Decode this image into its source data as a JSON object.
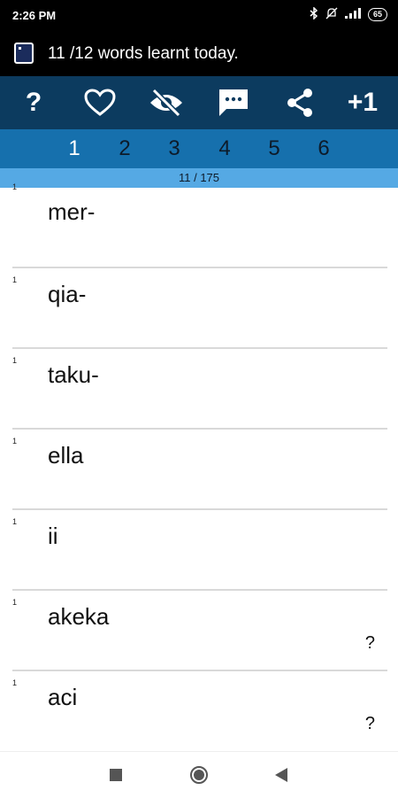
{
  "status": {
    "time": "2:26 PM",
    "battery": "65",
    "icons": [
      "bluetooth-icon",
      "mute-icon",
      "signal-icon",
      "battery-icon"
    ]
  },
  "notification": {
    "text": "11 /12 words learnt today."
  },
  "toolbar": {
    "help_label": "?",
    "plus_label": "+1",
    "icons": [
      "help-icon",
      "heart-icon",
      "eye-off-icon",
      "chat-icon",
      "share-icon",
      "plus-one-icon"
    ]
  },
  "tabs": [
    {
      "label": "1"
    },
    {
      "label": "2"
    },
    {
      "label": "3"
    },
    {
      "label": "4"
    },
    {
      "label": "5"
    },
    {
      "label": "6"
    }
  ],
  "active_tab": "1",
  "progress": "11 / 175",
  "words": [
    {
      "num": "1",
      "word": "mer-",
      "hint": ""
    },
    {
      "num": "1",
      "word": "qia-",
      "hint": ""
    },
    {
      "num": "1",
      "word": "taku-",
      "hint": ""
    },
    {
      "num": "1",
      "word": "ella",
      "hint": ""
    },
    {
      "num": "1",
      "word": "ii",
      "hint": ""
    },
    {
      "num": "1",
      "word": "akeka",
      "hint": "?"
    },
    {
      "num": "1",
      "word": "aci",
      "hint": "?"
    }
  ],
  "colors": {
    "toolbar": "#0c3b5f",
    "tabs": "#1670ad",
    "progress": "#55a9e4"
  }
}
